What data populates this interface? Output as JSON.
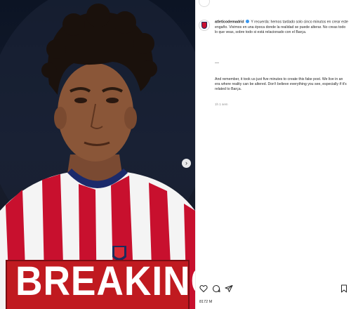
{
  "media": {
    "next_icon": "chevron-right-icon",
    "overlay_text": "BREAKING",
    "colors": {
      "stripe_red": "#c8102e",
      "stripe_white": "#f4f4f4",
      "banner_red": "#c01a20"
    }
  },
  "post": {
    "username": "atleticodemadrid",
    "verified": true,
    "caption_es": "Y recuerda: hemos tardado solo cinco minutos en crear este engaño. Vivimos en una época donde la realidad se puede alterar. No creas todo lo que veas, sobre todo si está relacionado con el Barça.",
    "separator": "—",
    "caption_en": "And remember, it took us just five minutes to create this fake post. We live in an era where reality can be altered. Don't believe everything you see, especially if it's related to Barça.",
    "time": "1h 1 sem",
    "likes": "8172 M"
  },
  "actions": {
    "like_icon": "heart-icon",
    "comment_icon": "comment-icon",
    "share_icon": "send-icon",
    "save_icon": "bookmark-icon"
  }
}
